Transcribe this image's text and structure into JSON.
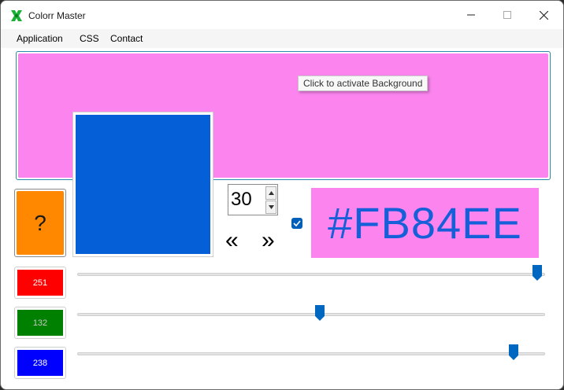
{
  "window": {
    "title": "Colorr Master"
  },
  "menu": {
    "items": [
      "Application",
      "CSS",
      "Contact"
    ]
  },
  "background_panel": {
    "color": "#FB84EE",
    "tooltip": "Click to activate Background"
  },
  "swatch": {
    "color": "#055FD6"
  },
  "random_button": {
    "label": "?",
    "color": "#FF8800"
  },
  "step": {
    "value": "30",
    "prev_label": "«",
    "next_label": "»"
  },
  "lock_checkbox": {
    "checked": true
  },
  "hex_display": {
    "text": "#FB84EE",
    "background": "#FB84EE",
    "text_color": "#1560D8"
  },
  "channels": [
    {
      "name": "red",
      "value": "251",
      "color": "#FF0000",
      "text_color": "#FFFFFF",
      "fraction": 0.984
    },
    {
      "name": "green",
      "value": "132",
      "color": "#008000",
      "text_color": "#C8C8C8",
      "fraction": 0.518
    },
    {
      "name": "blue",
      "value": "238",
      "color": "#0000FF",
      "text_color": "#FFFFFF",
      "fraction": 0.933
    }
  ],
  "accent_color": "#0067C0"
}
